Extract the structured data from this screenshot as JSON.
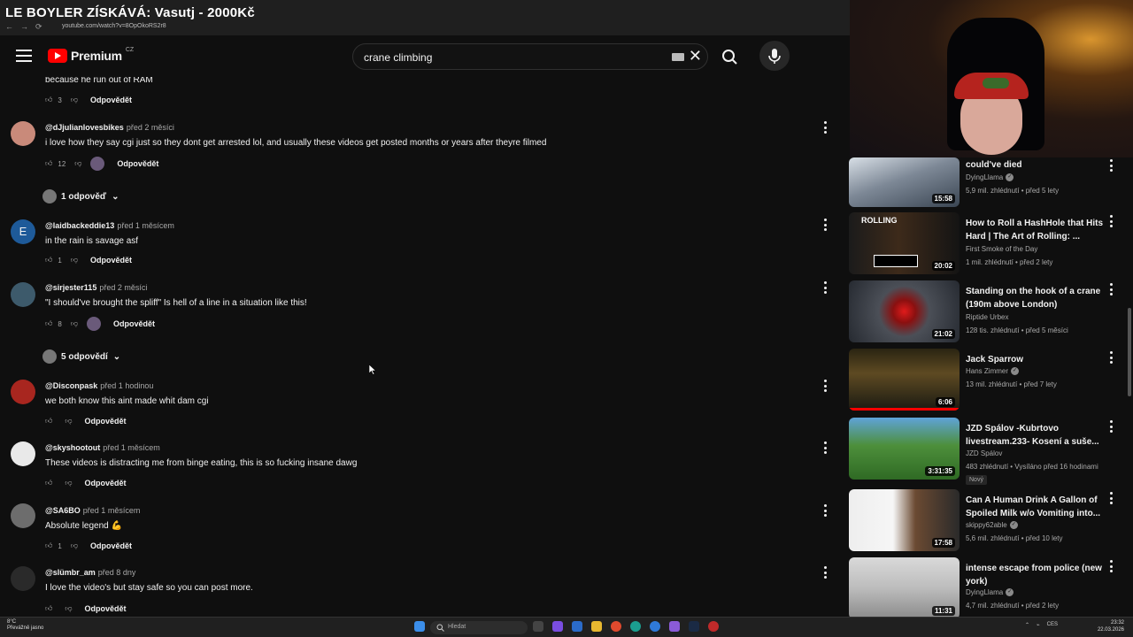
{
  "browser": {
    "overlay_title": "LE BOYLER ZÍSKÁVÁ: Vasutj - 2000Kč",
    "url": "youtube.com/watch?v=8OpOkoRS2r8"
  },
  "header": {
    "logo_text": "Premium",
    "country": "CZ",
    "search_value": "crane climbing"
  },
  "top_comment": {
    "text": "because he run out of RAM",
    "likes": "3",
    "reply_label": "Odpovědět"
  },
  "comments": [
    {
      "author": "@dJjulianlovesbikes",
      "time": "před 2 měsíci",
      "text": "i love how they say cgi just so they dont get arrested lol, and usually these videos get posted months or years after theyre filmed",
      "likes": "12",
      "reply_label": "Odpovědět",
      "replies": "1 odpověď",
      "avatar_color": "#c98a7a"
    },
    {
      "author": "@laidbackeddie13",
      "time": "před 1 měsícem",
      "text": "in the rain is savage asf",
      "likes": "1",
      "reply_label": "Odpovědět",
      "replies": "",
      "avatar_letter": "E",
      "avatar_color": "#1e5a99"
    },
    {
      "author": "@sirjester115",
      "time": "před 2 měsíci",
      "text": "\"I should've brought the spliff\" Is hell of a line in a situation like this!",
      "likes": "8",
      "reply_label": "Odpovědět",
      "replies": "5 odpovědí",
      "avatar_color": "#3d5a6b"
    },
    {
      "author": "@Disconpask",
      "time": "před 1 hodinou",
      "text": "we both know this aint made whit dam cgi",
      "likes": "",
      "reply_label": "Odpovědět",
      "replies": "",
      "avatar_color": "#a8261f"
    },
    {
      "author": "@skyshootout",
      "time": "před 1 měsícem",
      "text": "These videos is distracting me from binge eating, this is so fucking insane dawg",
      "likes": "",
      "reply_label": "Odpovědět",
      "replies": "",
      "avatar_color": "#e9e9e9"
    },
    {
      "author": "@SA6BO",
      "time": "před 1 měsícem",
      "text": "Absolute legend 💪",
      "likes": "1",
      "reply_label": "Odpovědět",
      "replies": "",
      "avatar_color": "#6d6d6d"
    },
    {
      "author": "@slümbr_am",
      "time": "před 8 dny",
      "text": "I love the video's but stay safe so you can post more.",
      "likes": "",
      "reply_label": "Odpovědět",
      "replies": "",
      "avatar_color": "#2a2a2a"
    }
  ],
  "related": [
    {
      "title": "could've died",
      "channel": "DyingLlama",
      "verified": true,
      "meta": "5,9 mil. zhlédnutí • před 5 lety",
      "duration": "15:58",
      "new": ""
    },
    {
      "title": "How to Roll a HashHole that Hits Hard | The Art of Rolling: ...",
      "channel": "First Smoke of the Day",
      "verified": false,
      "meta": "1 mil. zhlédnutí • před 2 lety",
      "duration": "20:02",
      "new": ""
    },
    {
      "title": "Standing on the hook of a crane (190m above London)",
      "channel": "Riptide Urbex",
      "verified": false,
      "meta": "128 tis. zhlédnutí • před 5 měsíci",
      "duration": "21:02",
      "new": ""
    },
    {
      "title": "Jack Sparrow",
      "channel": "Hans Zimmer",
      "verified": true,
      "meta": "13 mil. zhlédnutí • před 7 lety",
      "duration": "6:06",
      "new": ""
    },
    {
      "title": "JZD Spálov -Kubrtovo livestream.233- Kosení a suše...",
      "channel": "JZD Spálov",
      "verified": false,
      "meta": "483 zhlédnutí • Vysíláno před 16 hodinami",
      "duration": "3:31:35",
      "new": "Nový"
    },
    {
      "title": "Can A Human Drink A Gallon of Spoiled Milk w/o Vomiting into...",
      "channel": "skippy62able",
      "verified": true,
      "meta": "5,6 mil. zhlédnutí • před 10 lety",
      "duration": "17:58",
      "new": ""
    },
    {
      "title": "intense escape from police (new york)",
      "channel": "DyingLlama",
      "verified": true,
      "meta": "4,7 mil. zhlédnutí • před 2 lety",
      "duration": "11:31",
      "new": ""
    }
  ],
  "taskbar": {
    "weather_temp": "8°C",
    "weather_desc": "Převážně jasno",
    "search_label": "Hledat",
    "lang": "CES",
    "time": "23:32",
    "date": "22.03.2026"
  },
  "colors": {
    "background": "#0f0f0f",
    "accent": "#ff0000",
    "text_secondary": "#aaaaaa"
  }
}
